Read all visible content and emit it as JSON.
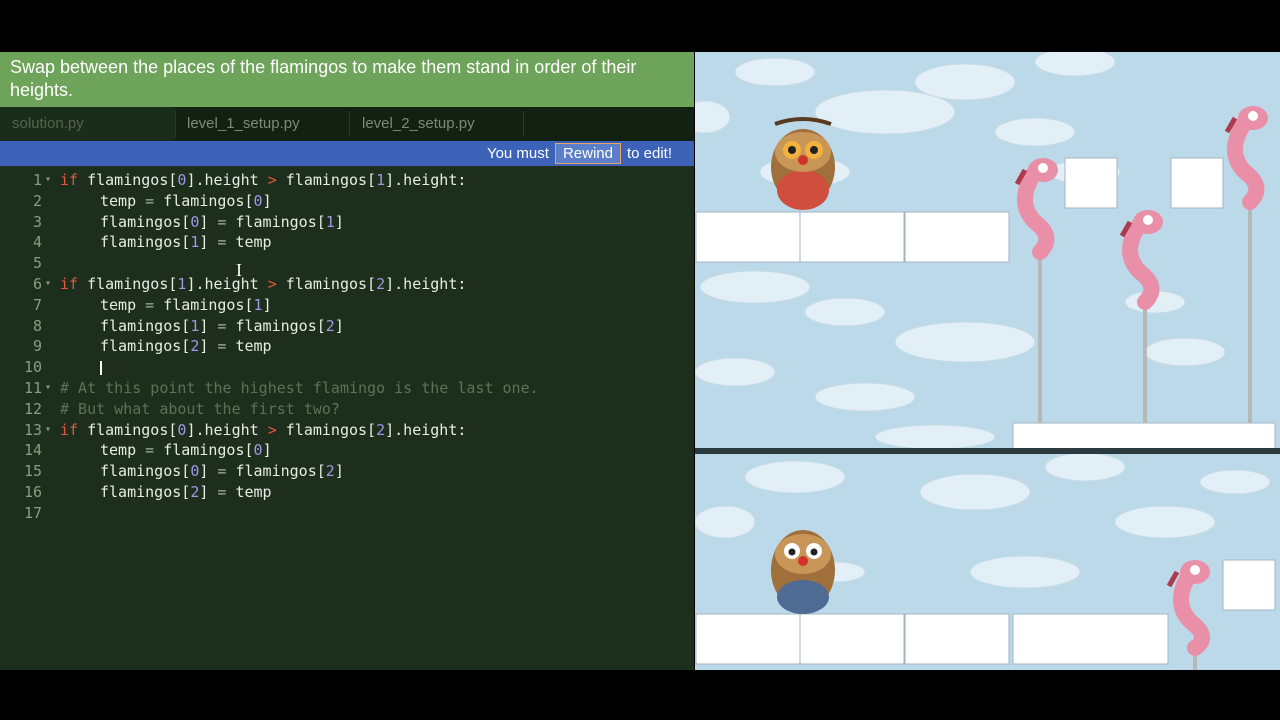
{
  "instructions": "Swap between the places of the flamingos to make them stand in order of their heights.",
  "tabs": [
    {
      "label": "solution.py",
      "active": true
    },
    {
      "label": "level_1_setup.py",
      "active": false
    },
    {
      "label": "level_2_setup.py",
      "active": false
    }
  ],
  "rewind_bar": {
    "prefix": "You must",
    "button": "Rewind",
    "suffix": "to edit!"
  },
  "code": {
    "lines": [
      {
        "n": "1",
        "fold": true,
        "indent": false,
        "comment": false,
        "text": "if flamingos[0].height > flamingos[1].height:"
      },
      {
        "n": "2",
        "fold": false,
        "indent": true,
        "comment": false,
        "text": "temp = flamingos[0]"
      },
      {
        "n": "3",
        "fold": false,
        "indent": true,
        "comment": false,
        "text": "flamingos[0] = flamingos[1]"
      },
      {
        "n": "4",
        "fold": false,
        "indent": true,
        "comment": false,
        "text": "flamingos[1] = temp"
      },
      {
        "n": "5",
        "fold": false,
        "indent": false,
        "comment": false,
        "text": ""
      },
      {
        "n": "6",
        "fold": true,
        "indent": false,
        "comment": false,
        "text": "if flamingos[1].height > flamingos[2].height:"
      },
      {
        "n": "7",
        "fold": false,
        "indent": true,
        "comment": false,
        "text": "temp = flamingos[1]"
      },
      {
        "n": "8",
        "fold": false,
        "indent": true,
        "comment": false,
        "text": "flamingos[1] = flamingos[2]"
      },
      {
        "n": "9",
        "fold": false,
        "indent": true,
        "comment": false,
        "text": "flamingos[2] = temp"
      },
      {
        "n": "10",
        "fold": false,
        "indent": true,
        "comment": false,
        "text": ""
      },
      {
        "n": "11",
        "fold": true,
        "indent": false,
        "comment": true,
        "text": "# At this point the highest flamingo is the last one."
      },
      {
        "n": "12",
        "fold": false,
        "indent": false,
        "comment": true,
        "text": "# But what about the first two?"
      },
      {
        "n": "13",
        "fold": true,
        "indent": false,
        "comment": false,
        "text": "if flamingos[0].height > flamingos[2].height:"
      },
      {
        "n": "14",
        "fold": false,
        "indent": true,
        "comment": false,
        "text": "temp = flamingos[0]"
      },
      {
        "n": "15",
        "fold": false,
        "indent": true,
        "comment": false,
        "text": "flamingos[0] = flamingos[2]"
      },
      {
        "n": "16",
        "fold": false,
        "indent": true,
        "comment": false,
        "text": "flamingos[2] = temp"
      },
      {
        "n": "17",
        "fold": false,
        "indent": false,
        "comment": false,
        "text": ""
      }
    ]
  },
  "colors": {
    "instructions_bg": "#6ea35a",
    "editor_bg": "#1d2e1d",
    "rewind_bar_bg": "#3c63b8",
    "keyword": "#e2573e",
    "number": "#9e97e8",
    "flamingo": "#e98fa8"
  }
}
